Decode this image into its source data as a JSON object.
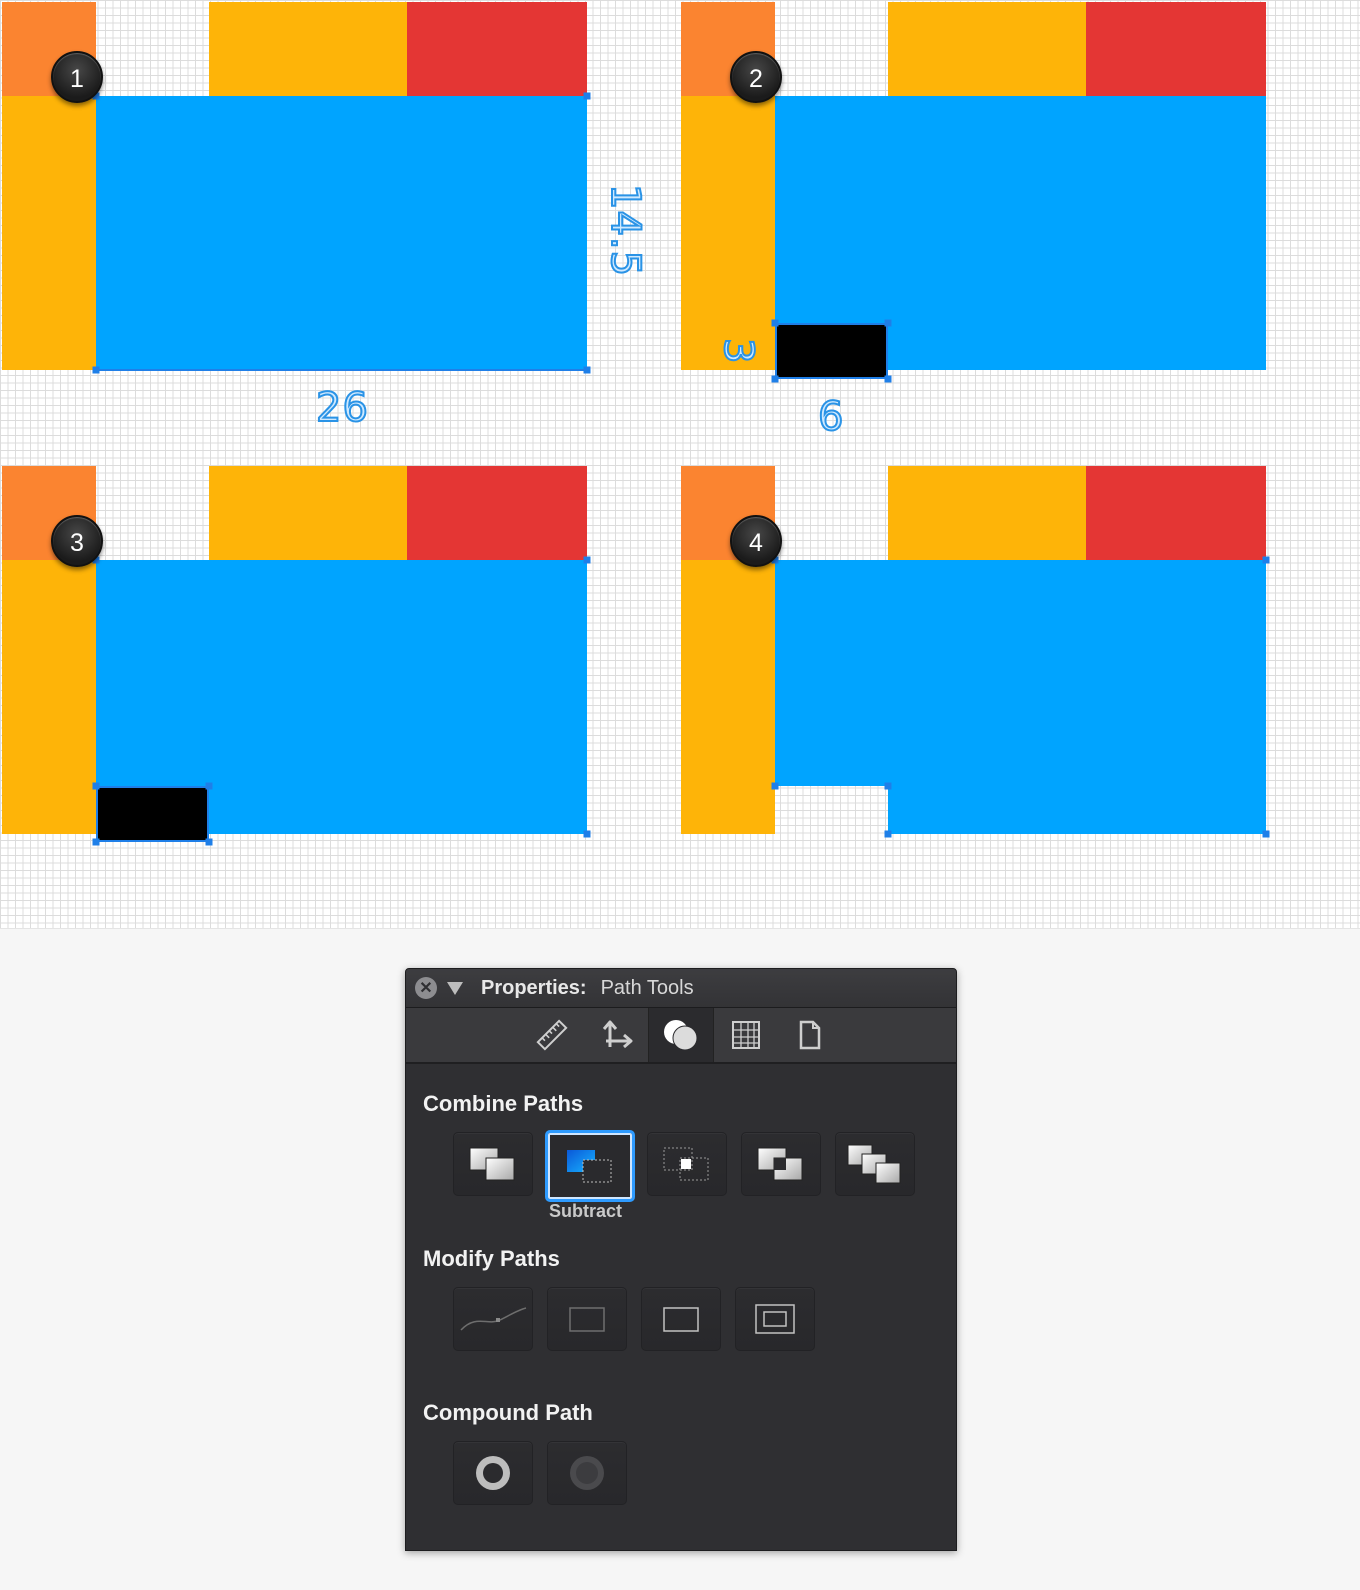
{
  "steps": {
    "one": "1",
    "two": "2",
    "three": "3",
    "four": "4"
  },
  "dimensions": {
    "height": "14.5",
    "width": "26",
    "small_height": "3",
    "small_width": "6"
  },
  "panel": {
    "title_bold": "Properties:",
    "title_rest": "Path Tools",
    "tabs": [
      "ruler-icon",
      "transform-icon",
      "path-tools-icon",
      "grid-icon",
      "document-icon"
    ],
    "combine_title": "Combine Paths",
    "combine_tools": [
      "add-icon",
      "subtract-icon",
      "intersect-icon",
      "exclude-icon",
      "divide-icon"
    ],
    "selected_tool_caption": "Subtract",
    "modify_title": "Modify Paths",
    "modify_tools": [
      "smooth-icon",
      "outline-stroke-icon",
      "offset-icon",
      "inset-icon"
    ],
    "compound_title": "Compound Path",
    "compound_tools": [
      "make-compound-icon",
      "release-compound-icon"
    ]
  },
  "colors": {
    "orange": "#fb8430",
    "amber": "#feb408",
    "red": "#e43634",
    "blue": "#00a4ff",
    "selection": "#1f7fe8",
    "panel_bg": "#2f2f32",
    "selected_tool_border": "#2e9bff"
  }
}
